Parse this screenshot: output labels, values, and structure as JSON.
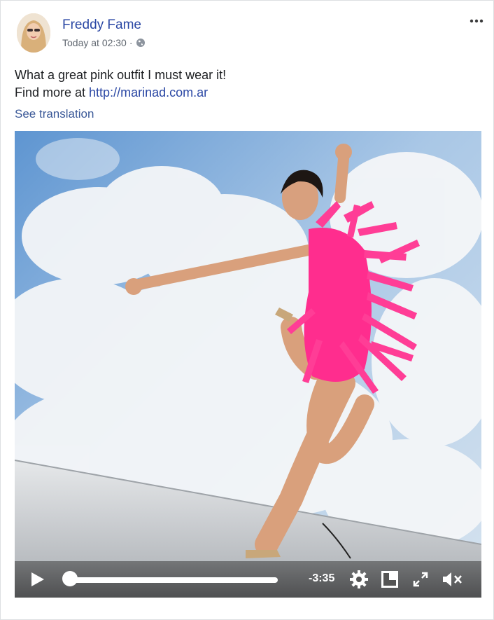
{
  "post": {
    "author": "Freddy Fame",
    "timestamp": "Today at 02:30",
    "separator": "·",
    "privacy_icon": "globe-icon",
    "more_icon": "more-options-icon",
    "text_line1": "What a great pink outfit I must wear it!",
    "text_line2_prefix": "Find more at ",
    "link": "http://marinad.com.ar",
    "see_translation": "See translation"
  },
  "video": {
    "remaining_time": "-3:35",
    "progress": 0,
    "controls": [
      "play-icon",
      "settings-icon",
      "picture-in-picture-icon",
      "fullscreen-icon",
      "mute-icon"
    ]
  },
  "colors": {
    "author_link": "#2a47a4",
    "meta_text": "#606770",
    "outfit_pink": "#ff2d8e",
    "sky": "#6aa0d8"
  }
}
